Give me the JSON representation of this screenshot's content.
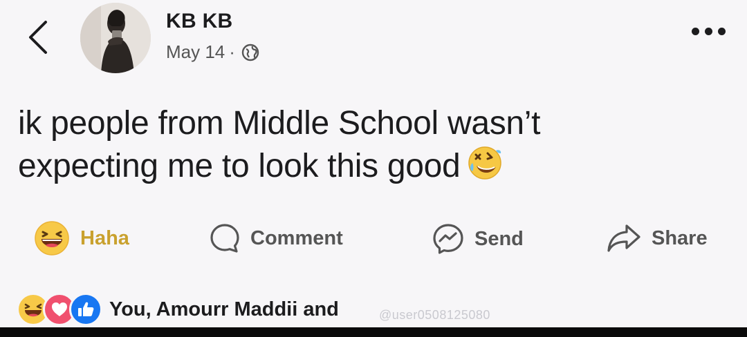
{
  "header": {
    "back_icon": "chevron-left-icon",
    "author": "KB KB",
    "date": "May 14",
    "separator": "·",
    "privacy_icon": "globe-icon",
    "more_icon": "more-horizontal-icon"
  },
  "post": {
    "line1": "ik people from Middle School wasn’t",
    "line2": "expecting me to look this good",
    "emoji": "rolling-on-floor-laughing-icon"
  },
  "actions": {
    "haha_label": "Haha",
    "comment_label": "Comment",
    "send_label": "Send",
    "share_label": "Share",
    "haha_color": "#c9a12e",
    "muted_color": "#555555"
  },
  "reactions": {
    "icons": [
      "haha-reaction-icon",
      "love-reaction-icon",
      "like-reaction-icon"
    ],
    "text": "You, Amourr Maddii and"
  },
  "watermark": "@user0508125080"
}
